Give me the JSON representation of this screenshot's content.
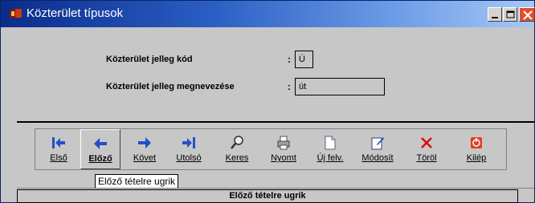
{
  "window": {
    "title": "Közterület típusok"
  },
  "form": {
    "code_label": "Közterület jelleg kód",
    "code_value": "Ú",
    "name_label": "Közterület jelleg megnevezése",
    "name_value": "út",
    "colon": ":"
  },
  "toolbar": {
    "buttons": [
      {
        "label": "Első",
        "icon": "first-arrow-icon"
      },
      {
        "label": "Előző",
        "icon": "prev-arrow-icon"
      },
      {
        "label": "Követ",
        "icon": "next-arrow-icon"
      },
      {
        "label": "Utolsó",
        "icon": "last-arrow-icon"
      },
      {
        "label": "Keres",
        "icon": "magnifier-icon"
      },
      {
        "label": "Nyomt",
        "icon": "printer-icon"
      },
      {
        "label": "Új felv.",
        "icon": "new-document-icon"
      },
      {
        "label": "Módosít",
        "icon": "edit-icon"
      },
      {
        "label": "Töröl",
        "icon": "delete-x-icon"
      },
      {
        "label": "Kilép",
        "icon": "exit-icon"
      }
    ]
  },
  "tooltip": "Előző tételre ugrik",
  "statusbar": {
    "text": "Előző tételre ugrik"
  },
  "colors": {
    "arrow_blue": "#2450c8",
    "delete_red": "#d01010",
    "exit_red": "#e04020"
  }
}
